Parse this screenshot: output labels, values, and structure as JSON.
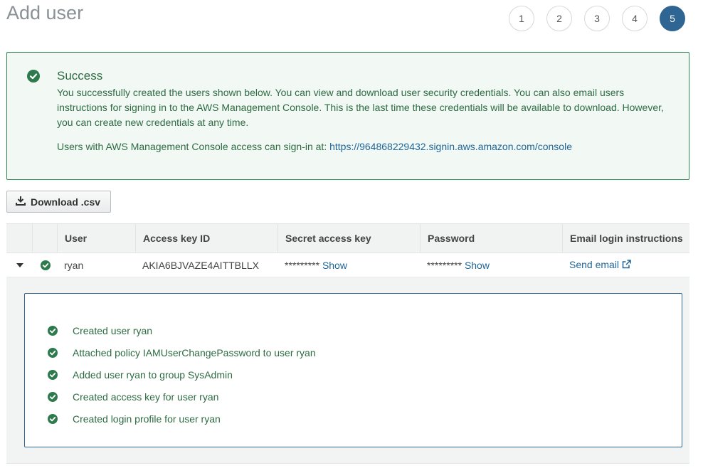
{
  "page": {
    "title": "Add user"
  },
  "steps": [
    "1",
    "2",
    "3",
    "4",
    "5"
  ],
  "active_step": "5",
  "alert": {
    "title": "Success",
    "body": "You successfully created the users shown below. You can view and download user security credentials. You can also email users instructions for signing in to the AWS Management Console. This is the last time these credentials will be available to download. However, you can create new credentials at any time.",
    "signin_prefix": "Users with AWS Management Console access can sign-in at: ",
    "signin_url": "https://964868229432.signin.aws.amazon.com/console"
  },
  "download_button": {
    "label": "Download .csv",
    "icon": "download-icon"
  },
  "table": {
    "headers": {
      "user": "User",
      "access_key": "Access key ID",
      "secret": "Secret access key",
      "password": "Password",
      "email": "Email login instructions"
    },
    "rows": [
      {
        "user": "ryan",
        "access_key": "AKIA6BJVAZE4AITTBLLX",
        "secret_mask": "********* ",
        "secret_action": "Show",
        "password_mask": "********* ",
        "password_action": "Show",
        "email_action": "Send email"
      }
    ]
  },
  "log": [
    "Created user ryan",
    "Attached policy IAMUserChangePassword to user ryan",
    "Added user ryan to group SysAdmin",
    "Created access key for user ryan",
    "Created login profile for user ryan"
  ],
  "colors": {
    "accent": "#2e6592",
    "success": "#2d7a4c",
    "link": "#1f6598"
  }
}
